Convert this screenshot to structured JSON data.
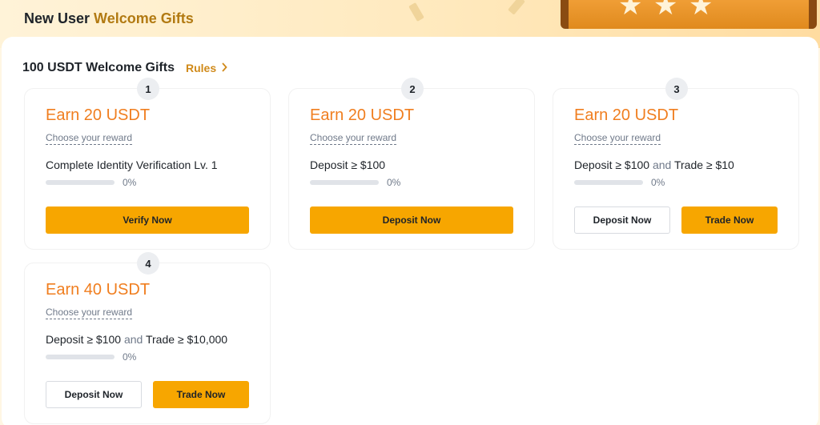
{
  "banner": {
    "title_part1": "New User ",
    "title_part2": "Welcome Gifts"
  },
  "section": {
    "title": "100 USDT Welcome Gifts",
    "rules_label": "Rules"
  },
  "common": {
    "choose_reward": "Choose your reward",
    "and_word": "and"
  },
  "cards": [
    {
      "step": "1",
      "earn": "Earn 20 USDT",
      "task": "Complete Identity Verification Lv. 1",
      "progress_percent": 0,
      "progress_text": "0%",
      "button_primary": "Verify Now"
    },
    {
      "step": "2",
      "earn": "Earn 20 USDT",
      "task": "Deposit ≥ $100",
      "progress_percent": 0,
      "progress_text": "0%",
      "button_primary": "Deposit Now"
    },
    {
      "step": "3",
      "earn": "Earn 20 USDT",
      "task_a": "Deposit ≥ $100",
      "task_b": "Trade ≥ $10",
      "progress_percent": 0,
      "progress_text": "0%",
      "button_secondary": "Deposit Now",
      "button_primary": "Trade Now"
    },
    {
      "step": "4",
      "earn": "Earn 40 USDT",
      "task_a": "Deposit ≥ $100",
      "task_b": "Trade ≥ $10,000",
      "progress_percent": 0,
      "progress_text": "0%",
      "button_secondary": "Deposit Now",
      "button_primary": "Trade Now"
    }
  ],
  "colors": {
    "accent_orange": "#f07e1f",
    "button_yellow": "#f7a600",
    "rules_link": "#d08a1a"
  }
}
